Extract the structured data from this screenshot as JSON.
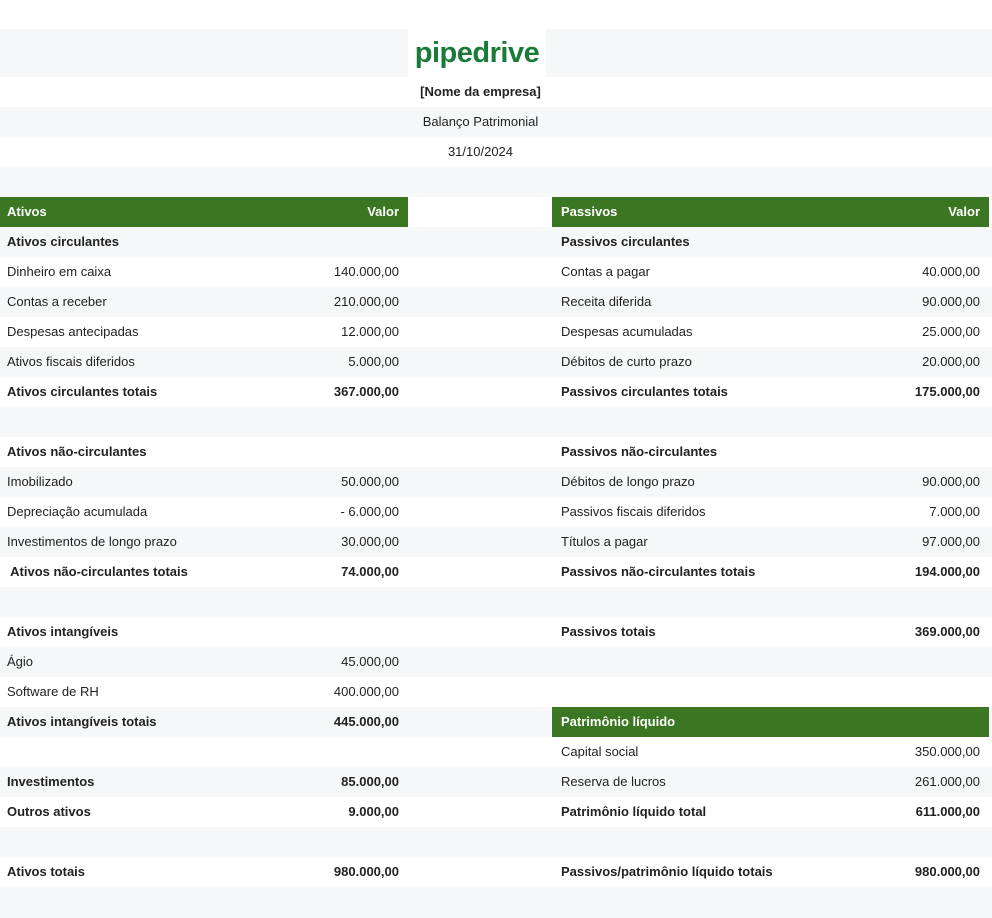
{
  "header": {
    "logo": "pipedrive",
    "company": "[Nome da empresa]",
    "title": "Balanço Patrimonial",
    "date": "31/10/2024"
  },
  "colors": {
    "header_green": "#3b7722",
    "logo_green": "#1a7a3a",
    "stripe": "#f6f7f9"
  },
  "assets": {
    "heading": "Ativos",
    "value_heading": "Valor",
    "current": {
      "title": "Ativos circulantes",
      "items": [
        {
          "label": "Dinheiro em caixa",
          "value": "140.000,00"
        },
        {
          "label": "Contas a receber",
          "value": "210.000,00"
        },
        {
          "label": "Despesas antecipadas",
          "value": "12.000,00"
        },
        {
          "label": "Ativos fiscais diferidos",
          "value": "5.000,00"
        }
      ],
      "total_label": "Ativos circulantes totais",
      "total_value": "367.000,00"
    },
    "noncurrent": {
      "title": "Ativos não-circulantes",
      "items": [
        {
          "label": "Imobilizado",
          "value": "50.000,00"
        },
        {
          "label": "Depreciação acumulada",
          "value": "- 6.000,00"
        },
        {
          "label": "Investimentos de longo prazo",
          "value": "30.000,00"
        }
      ],
      "total_label": " Ativos não-circulantes totais",
      "total_value": "74.000,00"
    },
    "intangible": {
      "title": "Ativos intangíveis",
      "items": [
        {
          "label": "Ágio",
          "value": "45.000,00"
        },
        {
          "label": "Software de RH",
          "value": "400.000,00"
        }
      ],
      "total_label": "Ativos intangíveis totais",
      "total_value": "445.000,00"
    },
    "investments": {
      "label": "Investimentos",
      "value": "85.000,00"
    },
    "other": {
      "label": "Outros ativos",
      "value": "9.000,00"
    },
    "total": {
      "label": "Ativos totais",
      "value": "980.000,00"
    }
  },
  "liabilities": {
    "heading": "Passivos",
    "value_heading": "Valor",
    "current": {
      "title": "Passivos circulantes",
      "items": [
        {
          "label": "Contas a pagar",
          "value": "40.000,00"
        },
        {
          "label": "Receita diferida",
          "value": "90.000,00"
        },
        {
          "label": "Despesas acumuladas",
          "value": "25.000,00"
        },
        {
          "label": "Débitos de curto prazo",
          "value": "20.000,00"
        }
      ],
      "total_label": "Passivos circulantes totais",
      "total_value": "175.000,00"
    },
    "noncurrent": {
      "title": "Passivos não-circulantes",
      "items": [
        {
          "label": "Débitos de longo prazo",
          "value": "90.000,00"
        },
        {
          "label": "Passivos fiscais diferidos",
          "value": "7.000,00"
        },
        {
          "label": "Títulos a pagar",
          "value": "97.000,00"
        }
      ],
      "total_label": "Passivos não-circulantes totais",
      "total_value": "194.000,00"
    },
    "total": {
      "label": "Passivos totais",
      "value": "369.000,00"
    }
  },
  "equity": {
    "heading": "Patrimônio líquido",
    "items": [
      {
        "label": "Capital social",
        "value": "350.000,00"
      },
      {
        "label": "Reserva de lucros",
        "value": "261.000,00"
      }
    ],
    "total_label": "Patrimônio líquido total",
    "total_value": "611.000,00"
  },
  "grand_total": {
    "label": "Passivos/patrimônio líquido totais",
    "value": "980.000,00"
  }
}
